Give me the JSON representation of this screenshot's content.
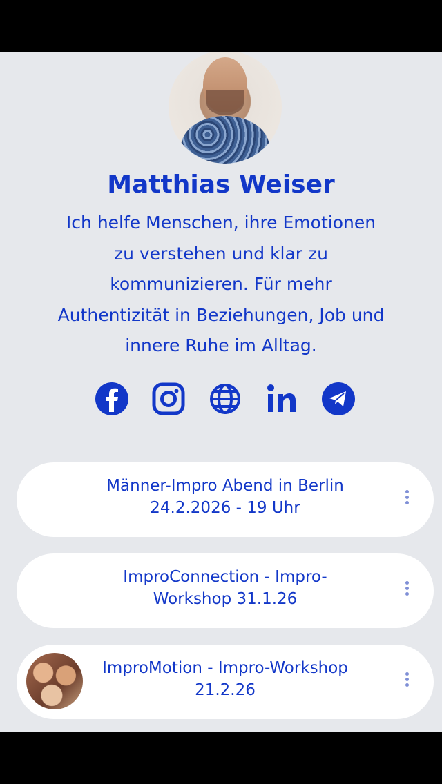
{
  "profile": {
    "name": "Matthias Weiser",
    "bio": "Ich helfe Menschen, ihre Emotionen zu verstehen und klar zu kommunizieren. Für mehr Authentizität in Beziehungen, Job und innere Ruhe im Alltag."
  },
  "socials": [
    {
      "icon": "facebook-icon"
    },
    {
      "icon": "instagram-icon"
    },
    {
      "icon": "globe-icon"
    },
    {
      "icon": "linkedin-icon"
    },
    {
      "icon": "telegram-icon"
    }
  ],
  "links": [
    {
      "title": "Männer-Impro Abend in Berlin 24.2.2026 - 19 Uhr"
    },
    {
      "title": "ImproConnection - Impro-Workshop 31.1.26"
    },
    {
      "title": "ImproMotion - Impro-Workshop 21.2.26"
    }
  ],
  "colors": {
    "accent": "#1237c8",
    "background": "#e6e8ec",
    "card": "#ffffff"
  }
}
